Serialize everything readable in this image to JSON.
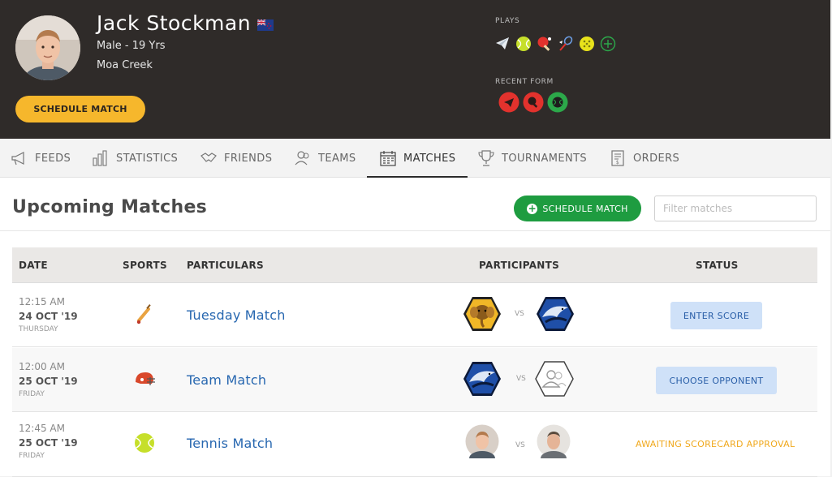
{
  "profile": {
    "name": "Jack Stockman",
    "gender_age": "Male - 19 Yrs",
    "location": "Moa Creek",
    "schedule_label": "SCHEDULE MATCH",
    "plays_label": "PLAYS",
    "recent_form_label": "RECENT FORM",
    "plays_icons": [
      "paper-plane-icon",
      "tennis-ball-icon",
      "table-tennis-icon",
      "badminton-icon",
      "pickleball-icon",
      "add-sport-icon"
    ],
    "recent_form": [
      {
        "icon": "paper-plane-icon",
        "result": "loss"
      },
      {
        "icon": "table-tennis-icon",
        "result": "loss"
      },
      {
        "icon": "tennis-ball-icon",
        "result": "win"
      }
    ]
  },
  "tabs": [
    {
      "label": "FEEDS",
      "icon": "megaphone-icon"
    },
    {
      "label": "STATISTICS",
      "icon": "chart-icon"
    },
    {
      "label": "FRIENDS",
      "icon": "handshake-icon"
    },
    {
      "label": "TEAMS",
      "icon": "users-icon"
    },
    {
      "label": "MATCHES",
      "icon": "calendar-icon",
      "active": true
    },
    {
      "label": "TOURNAMENTS",
      "icon": "trophy-icon"
    },
    {
      "label": "ORDERS",
      "icon": "receipt-icon"
    }
  ],
  "page": {
    "title": "Upcoming Matches",
    "schedule_label": "SCHEDULE MATCH",
    "filter_placeholder": "Filter matches"
  },
  "table": {
    "headers": [
      "DATE",
      "SPORTS",
      "PARTICULARS",
      "PARTICIPANTS",
      "STATUS"
    ],
    "rows": [
      {
        "time": "12:15 AM",
        "date": "24 OCT '19",
        "day": "THURSDAY",
        "sport_icon": "cricket-bat-icon",
        "particular": "Tuesday Match",
        "participant_a": "elephant-team-icon",
        "vs": "VS",
        "participant_b": "eagle-team-icon",
        "status": "ENTER SCORE",
        "status_type": "button"
      },
      {
        "time": "12:00 AM",
        "date": "25 OCT '19",
        "day": "FRIDAY",
        "sport_icon": "football-helmet-icon",
        "particular": "Team Match",
        "participant_a": "eagle-team-icon",
        "vs": "VS",
        "participant_b": "placeholder-team-icon",
        "status": "CHOOSE OPPONENT",
        "status_type": "button"
      },
      {
        "time": "12:45 AM",
        "date": "25 OCT '19",
        "day": "FRIDAY",
        "sport_icon": "tennis-ball-icon",
        "particular": "Tennis Match",
        "participant_a": "player-avatar",
        "vs": "VS",
        "participant_b": "opponent-avatar",
        "status": "AWAITING SCORECARD APPROVAL",
        "status_type": "text"
      }
    ]
  },
  "colors": {
    "header_bg": "#2f2b29",
    "accent_yellow": "#f6b72c",
    "accent_green": "#1e9c40",
    "link_blue": "#2767b0",
    "status_amber": "#f0a81c",
    "loss_red": "#e2322d"
  }
}
